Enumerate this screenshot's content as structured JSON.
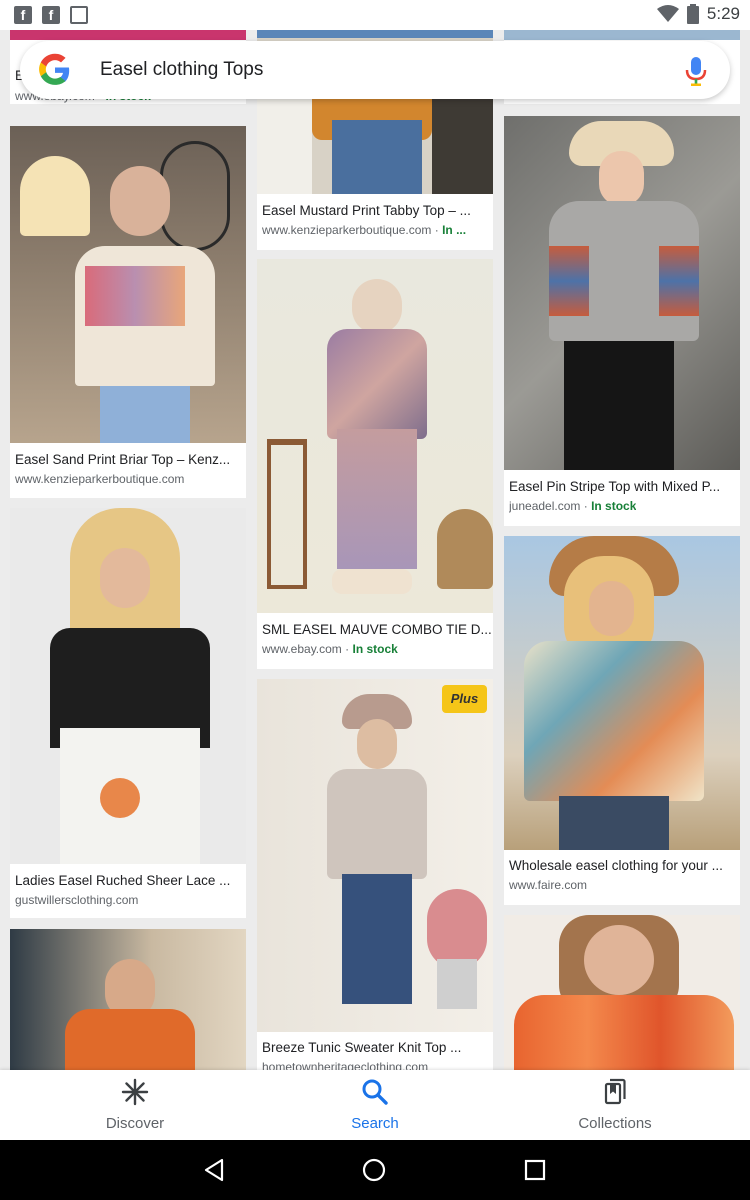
{
  "status_bar": {
    "time": "5:29"
  },
  "search": {
    "query": "Easel clothing Tops"
  },
  "results": [
    {
      "title": "E",
      "source": "www.ebay.com",
      "stock": "In stock"
    },
    {
      "title": "Easel Mustard Print Tabby Top – ...",
      "source": "www.kenzieparkerboutique.com",
      "stock": "In ..."
    },
    {
      "title": "",
      "source": "",
      "stock": ""
    },
    {
      "title": "Easel Sand Print Briar Top – Kenz...",
      "source": "www.kenzieparkerboutique.com",
      "stock": ""
    },
    {
      "title": "SML EASEL MAUVE COMBO TIE D...",
      "source": "www.ebay.com",
      "stock": "In stock"
    },
    {
      "title": "Easel Pin Stripe Top with Mixed P...",
      "source": "juneadel.com",
      "stock": "In stock"
    },
    {
      "title": "Ladies Easel Ruched Sheer Lace ...",
      "source": "gustwillersclothing.com",
      "stock": ""
    },
    {
      "title": "Breeze Tunic Sweater Knit Top ...",
      "source": "hometownheritageclothing.com",
      "stock": ""
    },
    {
      "title": "Wholesale easel clothing for your ...",
      "source": "www.faire.com",
      "stock": ""
    },
    {
      "title": "",
      "source": "",
      "stock": ""
    },
    {
      "title": "",
      "source": "",
      "stock": ""
    }
  ],
  "plus_badge": "Plus",
  "bottom_nav": [
    {
      "label": "Discover",
      "icon": "asterisk-icon",
      "active": false
    },
    {
      "label": "Search",
      "icon": "search-icon",
      "active": true
    },
    {
      "label": "Collections",
      "icon": "collections-icon",
      "active": false
    }
  ],
  "colors": {
    "accent": "#1a73e8",
    "in_stock": "#188038"
  }
}
